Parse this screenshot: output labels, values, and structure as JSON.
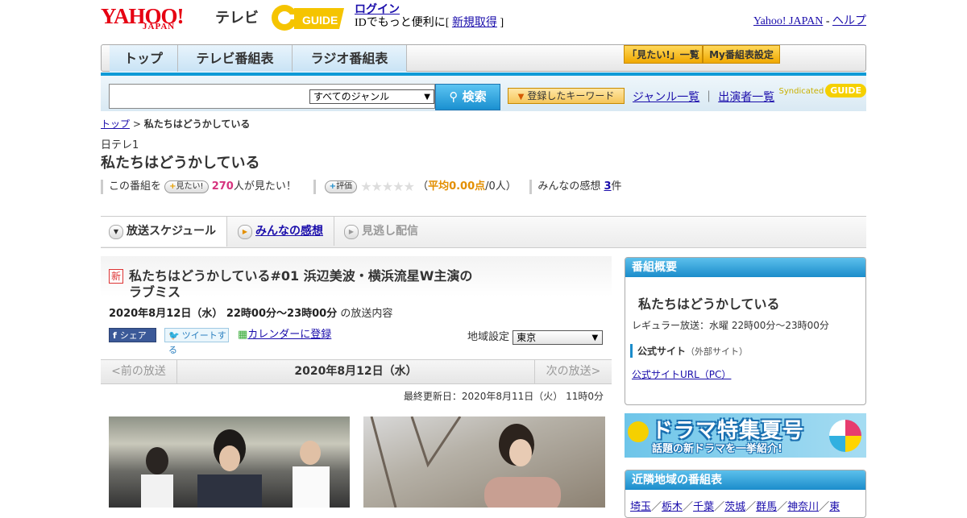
{
  "header": {
    "logo": "YAHOO!",
    "logo_sub": "JAPAN",
    "service": "テレビ",
    "gguide": "G GUIDE",
    "login": "ログイン",
    "login_prefix": "IDでもっと便利に[ ",
    "register": "新規取得",
    "login_suffix": " ]",
    "yahoo_japan": "Yahoo! JAPAN",
    "separator": " - ",
    "help": "ヘルプ"
  },
  "nav": {
    "tabs": [
      "トップ",
      "テレビ番組表",
      "ラジオ番組表"
    ],
    "want_list": "「見たい!」一覧",
    "my_settings": "My番組表設定"
  },
  "search": {
    "genre": "すべてのジャンル",
    "button": "検索",
    "keywords": "登録したキーワード",
    "genre_list": "ジャンル一覧",
    "divider": "｜",
    "performers": "出演者一覧",
    "syndicated": "Syndicated",
    "gguide": "GUIDE"
  },
  "breadcrumb": {
    "top": "トップ",
    "sep": " > ",
    "current": "私たちはどうかしている"
  },
  "program": {
    "channel": "日テレ1",
    "title": "私たちはどうかしている",
    "want_prefix": "この番組を",
    "want_button": "見たい!",
    "want_count": "270",
    "want_suffix": "人が見たい！",
    "rate_button": "評価",
    "stars": "★★★★★",
    "avg_open": "（",
    "avg": "平均0.00点",
    "avg_count": "/0人）",
    "impressions_label": "みんなの感想 ",
    "impressions_count": "3",
    "impressions_suffix": "件"
  },
  "subtabs": [
    "放送スケジュール",
    "みんなの感想",
    "見逃し配信"
  ],
  "episode": {
    "new_badge": "新",
    "title": "私たちはどうかしている#01 浜辺美波・横浜流星W主演のラブミス",
    "datetime": "2020年8月12日（水） 22時00分～23時00分",
    "suffix": " の放送内容",
    "facebook": "シェア",
    "tweet": "ツイートする",
    "calendar": "カレンダーに登録",
    "region_label": "地域設定",
    "region": "東京"
  },
  "pager": {
    "prev": "<前の放送",
    "date": "2020年8月12日（水）",
    "next": "次の放送>"
  },
  "updated": "最終更新日：2020年8月11日（火） 11時0分",
  "overview": {
    "header": "番組概要",
    "title": "私たちはどうかしている",
    "regular": "レギュラー放送：水曜 22時00分～23時00分",
    "site_label": "公式サイト",
    "site_note": "（外部サイト）",
    "site_url": "公式サイトURL（PC）"
  },
  "banner": {
    "big": "ドラマ特集夏号",
    "small": "話題の新ドラマを一挙紹介!"
  },
  "nearby": {
    "header": "近隣地域の番組表",
    "regions": [
      "埼玉",
      "栃木",
      "千葉",
      "茨城",
      "群馬",
      "神奈川",
      "東"
    ]
  },
  "colors": {
    "accent_blue": "#0e9ad6",
    "link": "#1a0dab",
    "pink": "#d6337e",
    "orange": "#e38f00",
    "yahoo_red": "#e60012"
  }
}
